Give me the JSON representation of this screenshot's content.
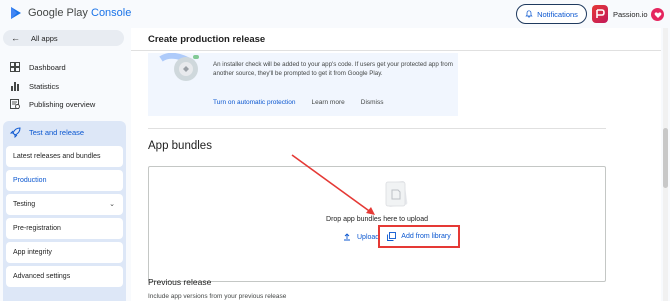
{
  "header": {
    "logo_text": "Google Play",
    "logo_accent": "Console",
    "notifications_label": "Notifications",
    "developer_name": "Passion.io"
  },
  "sidebar": {
    "all_apps_label": "All apps",
    "items": [
      {
        "label": "Dashboard",
        "icon": "dashboard-icon"
      },
      {
        "label": "Statistics",
        "icon": "bar-chart-icon"
      },
      {
        "label": "Publishing overview",
        "icon": "publishing-overview-icon"
      }
    ],
    "section": {
      "label": "Test and release",
      "icon": "rocket-icon",
      "subitems": [
        {
          "label": "Latest releases and bundles"
        },
        {
          "label": "Production"
        },
        {
          "label": "Testing"
        },
        {
          "label": "Pre-registration"
        },
        {
          "label": "App integrity"
        },
        {
          "label": "Advanced settings"
        }
      ]
    }
  },
  "main": {
    "title": "Create production release",
    "banner": {
      "text": "An installer check will be added to your app's code. If users get your protected app from another source, they'll be prompted to get it from Google Play.",
      "primary_link": "Turn on automatic protection",
      "learn_more": "Learn more",
      "dismiss": "Dismiss"
    },
    "app_bundles": {
      "heading": "App bundles",
      "drop_text": "Drop app bundles here to upload",
      "upload_label": "Upload",
      "library_label": "Add from library"
    },
    "previous_release": {
      "heading": "Previous release",
      "subtext": "Include app versions from your previous release"
    }
  },
  "colors": {
    "accent": "#0b57d0",
    "annotation": "#e53935",
    "section_bg": "#dde7f7"
  }
}
